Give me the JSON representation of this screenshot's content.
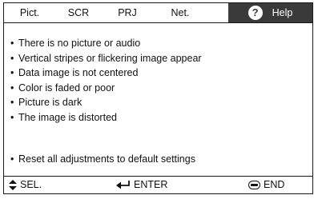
{
  "tabs": [
    {
      "label": "Pict."
    },
    {
      "label": "SCR"
    },
    {
      "label": "PRJ"
    },
    {
      "label": "Net."
    },
    {
      "label": "Help",
      "icon": "question-icon",
      "active": true
    }
  ],
  "help_icon_glyph": "?",
  "items": [
    "There is no picture or audio",
    "Vertical stripes or flickering image appear",
    "Data image is not centered",
    "Color is faded or poor",
    "Picture is dark",
    "The image is distorted"
  ],
  "reset_item": "Reset all adjustments to default settings",
  "bullet": "•",
  "footer": {
    "sel_label": "SEL.",
    "enter_label": "ENTER",
    "end_label": "END",
    "sel_icon": "up-down-arrows-icon",
    "enter_icon": "enter-arrow-icon",
    "end_icon": "end-button-icon"
  },
  "colors": {
    "active_tab_bg": "#3a3a3a",
    "border": "#1a1a1a",
    "text": "#111111"
  }
}
